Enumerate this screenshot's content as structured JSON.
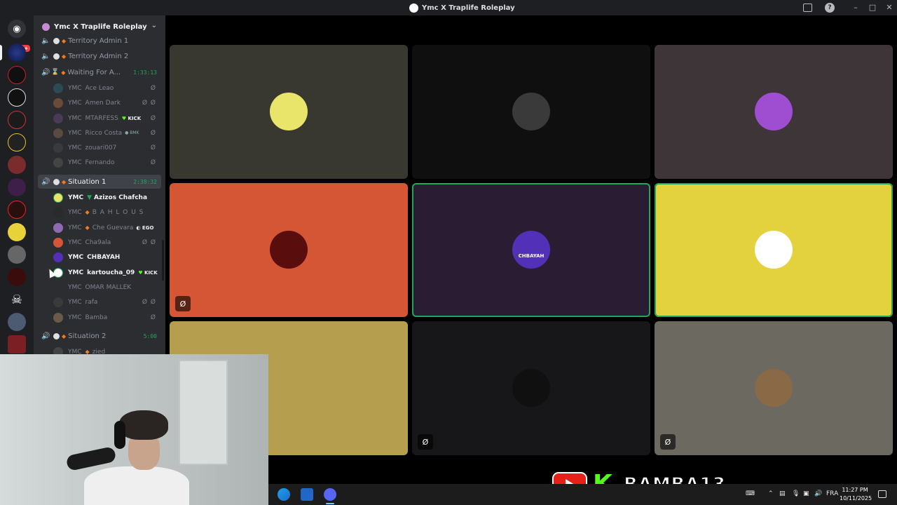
{
  "window": {
    "title": "Ymc X Traplife Roleplay"
  },
  "rail": {
    "badge": "1K+"
  },
  "guild": {
    "name": "Ymc X Traplife Roleplay"
  },
  "channels": [
    {
      "name": "Territory Admin 1",
      "timer": ""
    },
    {
      "name": "Territory Admin 2",
      "timer": ""
    },
    {
      "name": "Waiting For A...",
      "timer": "1:33:13"
    },
    {
      "name": "Situation 1",
      "timer": "2:38:32"
    },
    {
      "name": "Situation 2",
      "timer": "5:00"
    }
  ],
  "waiting_users": [
    {
      "prefix": "YMC",
      "name": "Ace Leao",
      "tag": ""
    },
    {
      "prefix": "YMC",
      "name": "Amen Dark",
      "tag": ""
    },
    {
      "prefix": "YMC",
      "name": "MTARFESS",
      "tag": "KICK"
    },
    {
      "prefix": "YMC",
      "name": "Ricco Costa",
      "tag": "BMK"
    },
    {
      "prefix": "YMC",
      "name": "zouari007",
      "tag": ""
    },
    {
      "prefix": "YMC",
      "name": "Fernando",
      "tag": ""
    }
  ],
  "situation1_users": [
    {
      "prefix": "YMC",
      "name": "Azizos Chafcha",
      "tag": ""
    },
    {
      "prefix": "YMC",
      "name": "B A H L O U S",
      "tag": ""
    },
    {
      "prefix": "YMC",
      "name": "Che Guevara",
      "tag": "EGO"
    },
    {
      "prefix": "YMC",
      "name": "Cha9ala",
      "tag": ""
    },
    {
      "prefix": "YMC",
      "name": "CHBAYAH",
      "tag": ""
    },
    {
      "prefix": "YMC",
      "name": "kartoucha_09",
      "tag": "KICK"
    },
    {
      "prefix": "YMC",
      "name": "OMAR MALLEK",
      "tag": ""
    },
    {
      "prefix": "YMC",
      "name": "rafa",
      "tag": ""
    },
    {
      "prefix": "YMC",
      "name": "Bamba",
      "tag": ""
    }
  ],
  "situation2_users": [
    {
      "prefix": "YMC",
      "name": "zied",
      "tag": ""
    }
  ],
  "tiles": [
    {
      "bg": "#393830",
      "avatar": "#e9e46a"
    },
    {
      "bg": "#0f0f10",
      "avatar": "#3a3a3a"
    },
    {
      "bg": "#3e3539",
      "avatar": "#a04ed1"
    },
    {
      "bg": "#d45634",
      "avatar": "#5a0d0d"
    },
    {
      "bg": "#2a1c33",
      "avatar": "#5231b8",
      "label": "CHBAYAH"
    },
    {
      "bg": "#e3d13e",
      "avatar": "#ffffff"
    },
    {
      "bg": "#b59f4e",
      "avatar": "#b59f4e"
    },
    {
      "bg": "#17171a",
      "avatar": "#101010"
    },
    {
      "bg": "#6c6960",
      "avatar": "#8a6a46"
    }
  ],
  "brand": {
    "name": "BAMBA13",
    "k": "K"
  },
  "taskbar": {
    "lang": "FRA",
    "time": "11:27 PM",
    "date": "10/11/2025"
  }
}
